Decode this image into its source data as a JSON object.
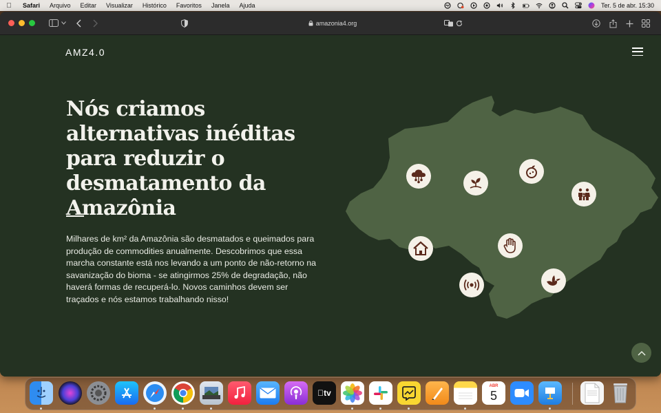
{
  "menubar": {
    "app_name": "Safari",
    "menus": [
      "Arquivo",
      "Editar",
      "Visualizar",
      "Histórico",
      "Favoritos",
      "Janela",
      "Ajuda"
    ],
    "clock": "Ter. 5 de abr.  15:30",
    "tray_icons": [
      "activity-icon",
      "vpn-icon",
      "play-icon",
      "record-icon",
      "volume-icon",
      "bluetooth-icon",
      "battery-icon",
      "wifi-icon",
      "user-icon",
      "search-icon",
      "control-center-icon",
      "siri-icon"
    ]
  },
  "browser": {
    "url": "amazonia4.org"
  },
  "site": {
    "logo": "AMZ4.0",
    "headline": {
      "line1": "Nós criamos alternativas inéditas para reduzir o",
      "bold1": "desmatamento",
      "mid": " da ",
      "bold2": "Amazônia"
    },
    "paragraph": "Milhares de km² da Amazônia são desmatados e queimados para produção de commodities anualmente. Descobrimos que essa marcha constante está nos levando a um ponto de não-retorno na savanização do bioma - se atingirmos 25% de degradação, não haverá formas de recuperá-lo. Novos caminhos devem ser traçados e nós estamos trabalhando nisso!",
    "map_icons": [
      "cloud-network-icon",
      "sprout-icon",
      "fruit-icon",
      "family-icon",
      "house-icon",
      "hand-icon",
      "signal-icon",
      "bird-icon"
    ],
    "colors": {
      "background": "#243222",
      "map": "#4f6344",
      "icon_fg": "#5b2a1c",
      "icon_bg": "#f5f1e8"
    }
  },
  "dock": {
    "apps": [
      "Finder",
      "Siri",
      "Preferências do Sistema",
      "App Store",
      "Safari",
      "Google Chrome",
      "Preview",
      "Música",
      "Mail",
      "Podcasts",
      "TV",
      "Fotos",
      "Slack",
      "Boards",
      "Pages",
      "Notas",
      "Calendário",
      "Zoom",
      "Keynote"
    ],
    "calendar_month": "ABR",
    "calendar_day": "5",
    "tv_label": "tv",
    "trash": "Lixo"
  }
}
